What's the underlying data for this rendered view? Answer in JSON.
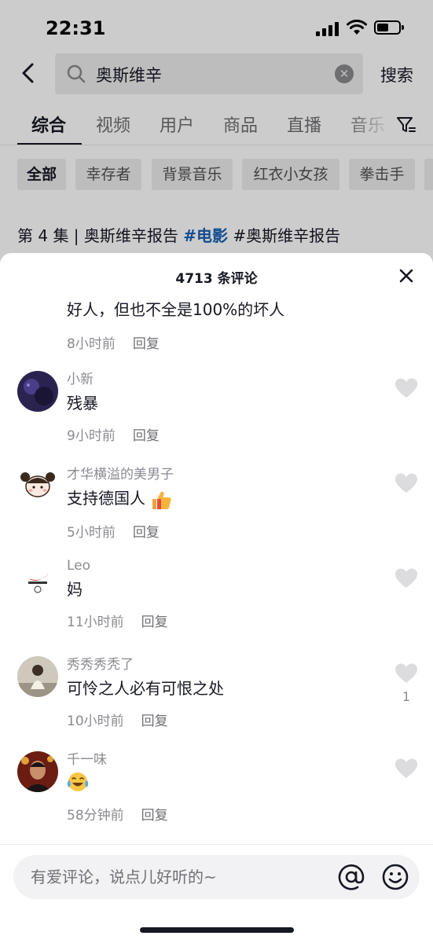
{
  "status_bar": {
    "time": "22:31"
  },
  "search": {
    "query": "奥斯维辛",
    "button_label": "搜索"
  },
  "tabs": [
    {
      "label": "综合",
      "active": true
    },
    {
      "label": "视频"
    },
    {
      "label": "用户"
    },
    {
      "label": "商品"
    },
    {
      "label": "直播"
    },
    {
      "label": "音乐"
    }
  ],
  "chips": [
    {
      "label": "全部",
      "active": true
    },
    {
      "label": "幸存者"
    },
    {
      "label": "背景音乐"
    },
    {
      "label": "红衣小女孩"
    },
    {
      "label": "拳击手"
    }
  ],
  "video": {
    "title_prefix": "第 4 集 | 奥斯维辛报告 ",
    "tag": "#电影",
    "title_suffix": " #奥斯维辛报告"
  },
  "comments_sheet": {
    "title": "4713 条评论",
    "partial_comment": {
      "text": "好人，但也不全是100%的坏人",
      "time": "8小时前",
      "reply": "回复"
    },
    "comments": [
      {
        "user": "小新",
        "text": "残暴",
        "time": "9小时前",
        "reply": "回复",
        "avatar": "dark-night-avatar"
      },
      {
        "user": "才华横溢的美男子",
        "text": "支持德国人",
        "emoji": "thumbs-up",
        "time": "5小时前",
        "reply": "回复",
        "avatar": "cartoon-girl-avatar"
      },
      {
        "user": "Leo",
        "text": "妈",
        "time": "11小时前",
        "reply": "回复",
        "avatar": "logo-avatar"
      },
      {
        "user": "秀秀秀秃了",
        "text": "可怜之人必有可恨之处",
        "time": "10小时前",
        "reply": "回复",
        "likes": "1",
        "avatar": "child-photo-avatar"
      },
      {
        "user": "千一味",
        "text": "",
        "emoji": "laughing-crying",
        "time": "58分钟前",
        "reply": "回复",
        "avatar": "person-red-avatar"
      }
    ],
    "input_placeholder": "有爱评论，说点儿好听的~"
  },
  "colors": {
    "hashtag": "#1a5fb4",
    "meta_text": "#8a8b91",
    "primary_text": "#161823",
    "like_icon": "#dcdcde"
  }
}
